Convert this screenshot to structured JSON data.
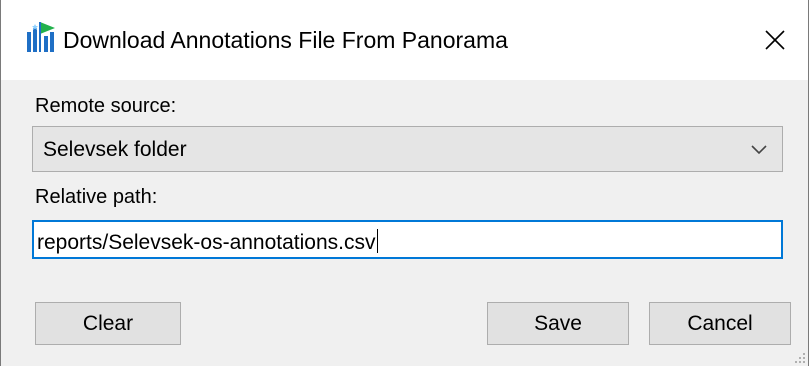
{
  "window": {
    "title": "Download Annotations File From Panorama",
    "icon": "panorama-app-icon",
    "close_icon": "close-icon"
  },
  "form": {
    "remote_source_label": "Remote source:",
    "remote_source_value": "Selevsek folder",
    "relative_path_label": "Relative path:",
    "relative_path_value": "reports/Selevsek-os-annotations.csv"
  },
  "buttons": {
    "clear": "Clear",
    "save": "Save",
    "cancel": "Cancel"
  },
  "colors": {
    "focus_border": "#0078d7",
    "dialog_background": "#f0f0f0",
    "button_face": "#e1e1e1",
    "icon_green": "#22b14c",
    "icon_blue": "#1f6fc5"
  }
}
